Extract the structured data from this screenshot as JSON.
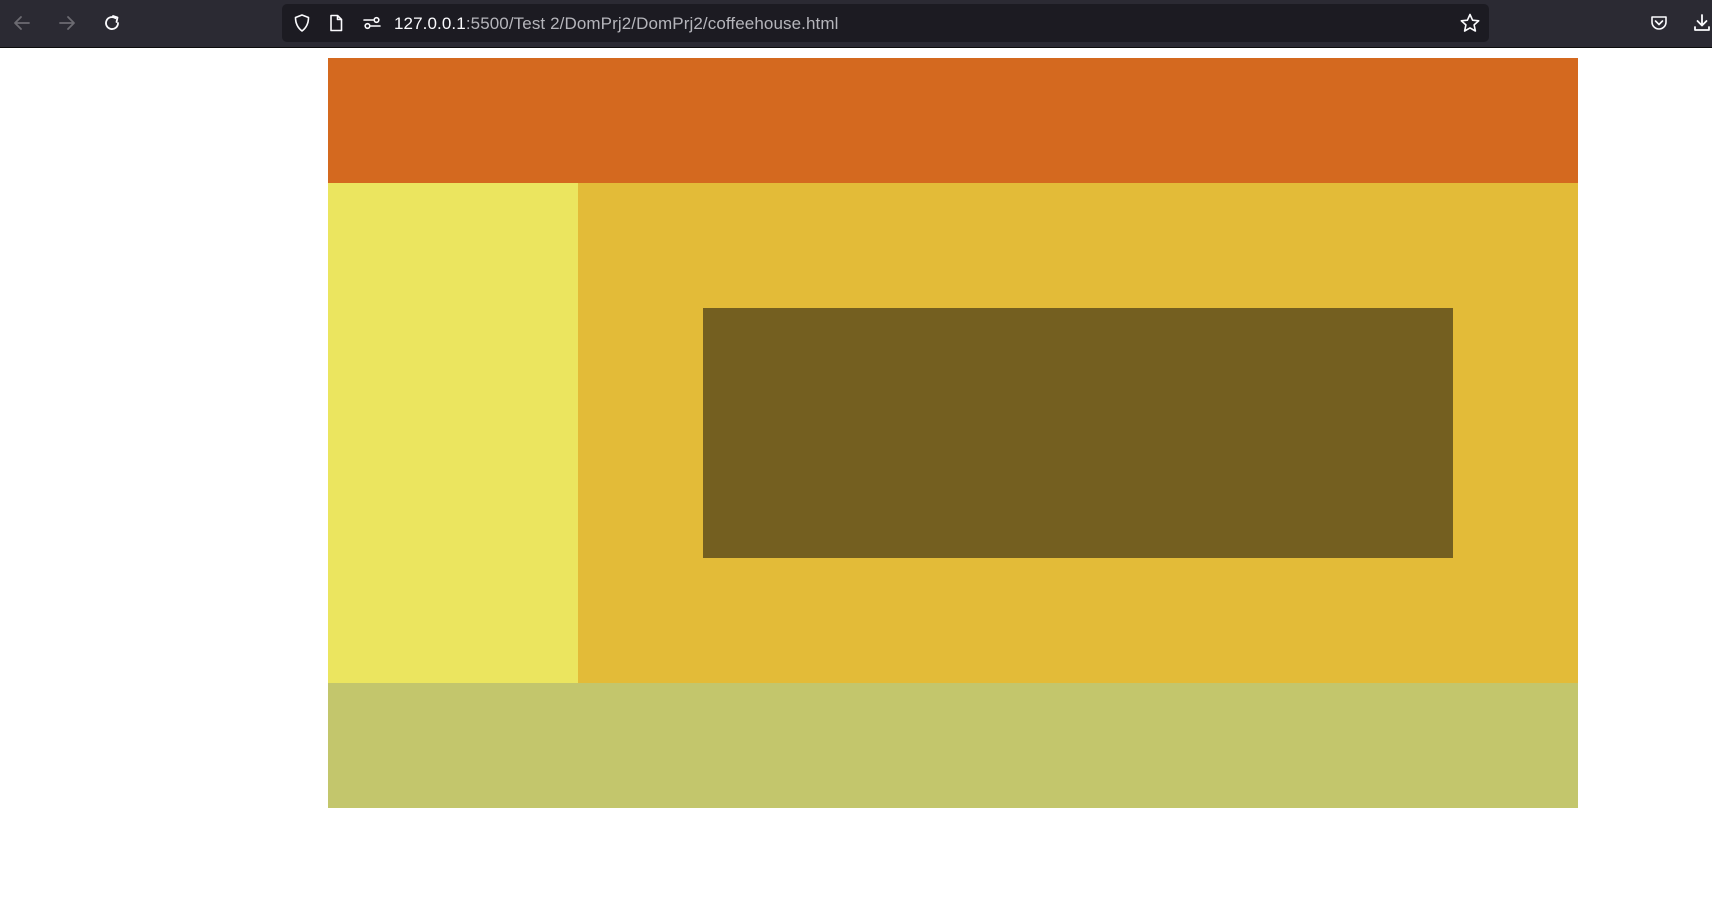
{
  "browser": {
    "url": {
      "host": "127.0.0.1",
      "rest": ":5500/Test 2/DomPrj2/DomPrj2/coffeehouse.html"
    },
    "icons": {
      "back": "back-arrow-icon",
      "forward": "forward-arrow-icon",
      "reload": "reload-icon",
      "shield": "shield-icon",
      "page": "page-icon",
      "permissions": "permissions-icon",
      "bookmark": "star-icon",
      "pocket": "pocket-icon",
      "downloads": "download-icon"
    },
    "colors": {
      "toolbar": "#2b2a33",
      "urlbar": "#1c1b22"
    }
  },
  "page": {
    "colors": {
      "header": "#d4691f",
      "sidebar": "#ebe55f",
      "main": "#e3bb38",
      "inner": "#745f20",
      "footer": "#c3c66c",
      "background": "#ffffff"
    }
  }
}
